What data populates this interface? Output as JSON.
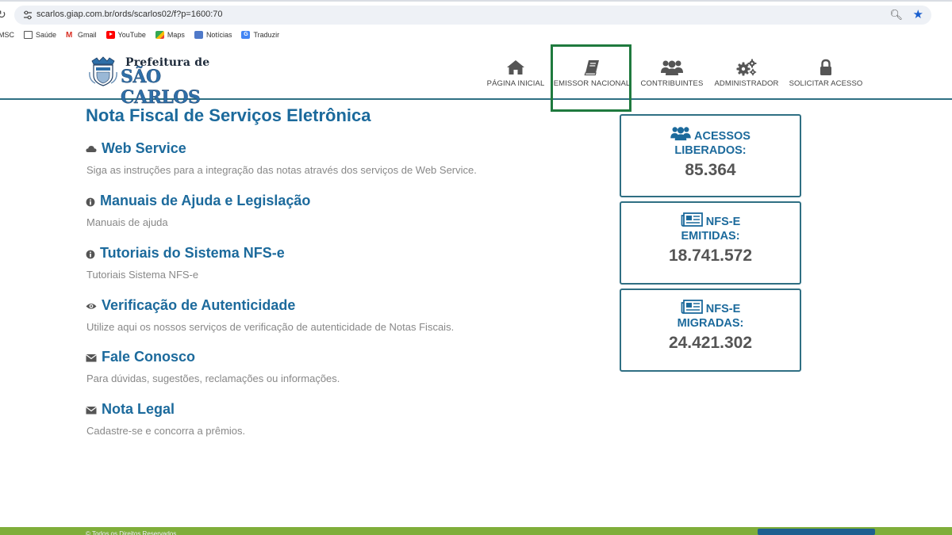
{
  "browser": {
    "url": "scarlos.giap.com.br/ords/scarlos02/f?p=1600:70",
    "bookmarks": [
      {
        "label": "MSC",
        "icon": "none"
      },
      {
        "label": "Saúde",
        "icon": "folder-icon"
      },
      {
        "label": "Gmail",
        "icon": "gmail-icon"
      },
      {
        "label": "YouTube",
        "icon": "youtube-icon"
      },
      {
        "label": "Maps",
        "icon": "maps-icon"
      },
      {
        "label": "Notícias",
        "icon": "news-icon"
      },
      {
        "label": "Traduzir",
        "icon": "translate-icon"
      }
    ]
  },
  "header": {
    "logo_top": "Prefeitura de",
    "logo_main": "SÃO CARLOS",
    "nav": [
      {
        "label": "PÁGINA INICIAL",
        "icon": "home-icon"
      },
      {
        "label": "EMISSOR NACIONAL",
        "icon": "book-icon"
      },
      {
        "label": "CONTRIBUINTES",
        "icon": "users-icon"
      },
      {
        "label": "ADMINISTRADOR",
        "icon": "gears-icon"
      },
      {
        "label": "SOLICITAR ACESSO",
        "icon": "lock-icon"
      }
    ]
  },
  "main": {
    "title": "Nota Fiscal de Serviços Eletrônica",
    "sections": [
      {
        "title": "Web Service",
        "desc": "Siga as instruções para a integração das notas através dos serviços de Web Service.",
        "icon": "cloud-icon"
      },
      {
        "title": "Manuais de Ajuda e Legislação",
        "desc": "Manuais de ajuda",
        "icon": "info-icon"
      },
      {
        "title": "Tutoriais do Sistema NFS-e",
        "desc": "Tutoriais Sistema NFS-e",
        "icon": "info-icon"
      },
      {
        "title": "Verificação de Autenticidade",
        "desc": "Utilize aqui os nossos serviços de verificação de autenticidade de Notas Fiscais.",
        "icon": "eye-icon"
      },
      {
        "title": "Fale Conosco",
        "desc": "Para dúvidas, sugestões, reclamações ou informações.",
        "icon": "envelope-icon"
      },
      {
        "title": "Nota Legal",
        "desc": "Cadastre-se e concorra a prêmios.",
        "icon": "envelope-icon"
      }
    ]
  },
  "stats": [
    {
      "line1": "ACESSOS",
      "line2": "LIBERADOS:",
      "value": "85.364",
      "icon": "users-icon"
    },
    {
      "line1": "NFS-E",
      "line2": "EMITIDAS:",
      "value": "18.741.572",
      "icon": "newspaper-icon"
    },
    {
      "line1": "NFS-E",
      "line2": "MIGRADAS:",
      "value": "24.421.302",
      "icon": "newspaper-icon"
    }
  ],
  "footer": {
    "text": "© Todos os Direitos Reservados"
  },
  "colors": {
    "primary": "#1c6a9c",
    "border": "#2f6f83",
    "highlight": "#1f7a3e",
    "footer": "#7fae3a"
  }
}
